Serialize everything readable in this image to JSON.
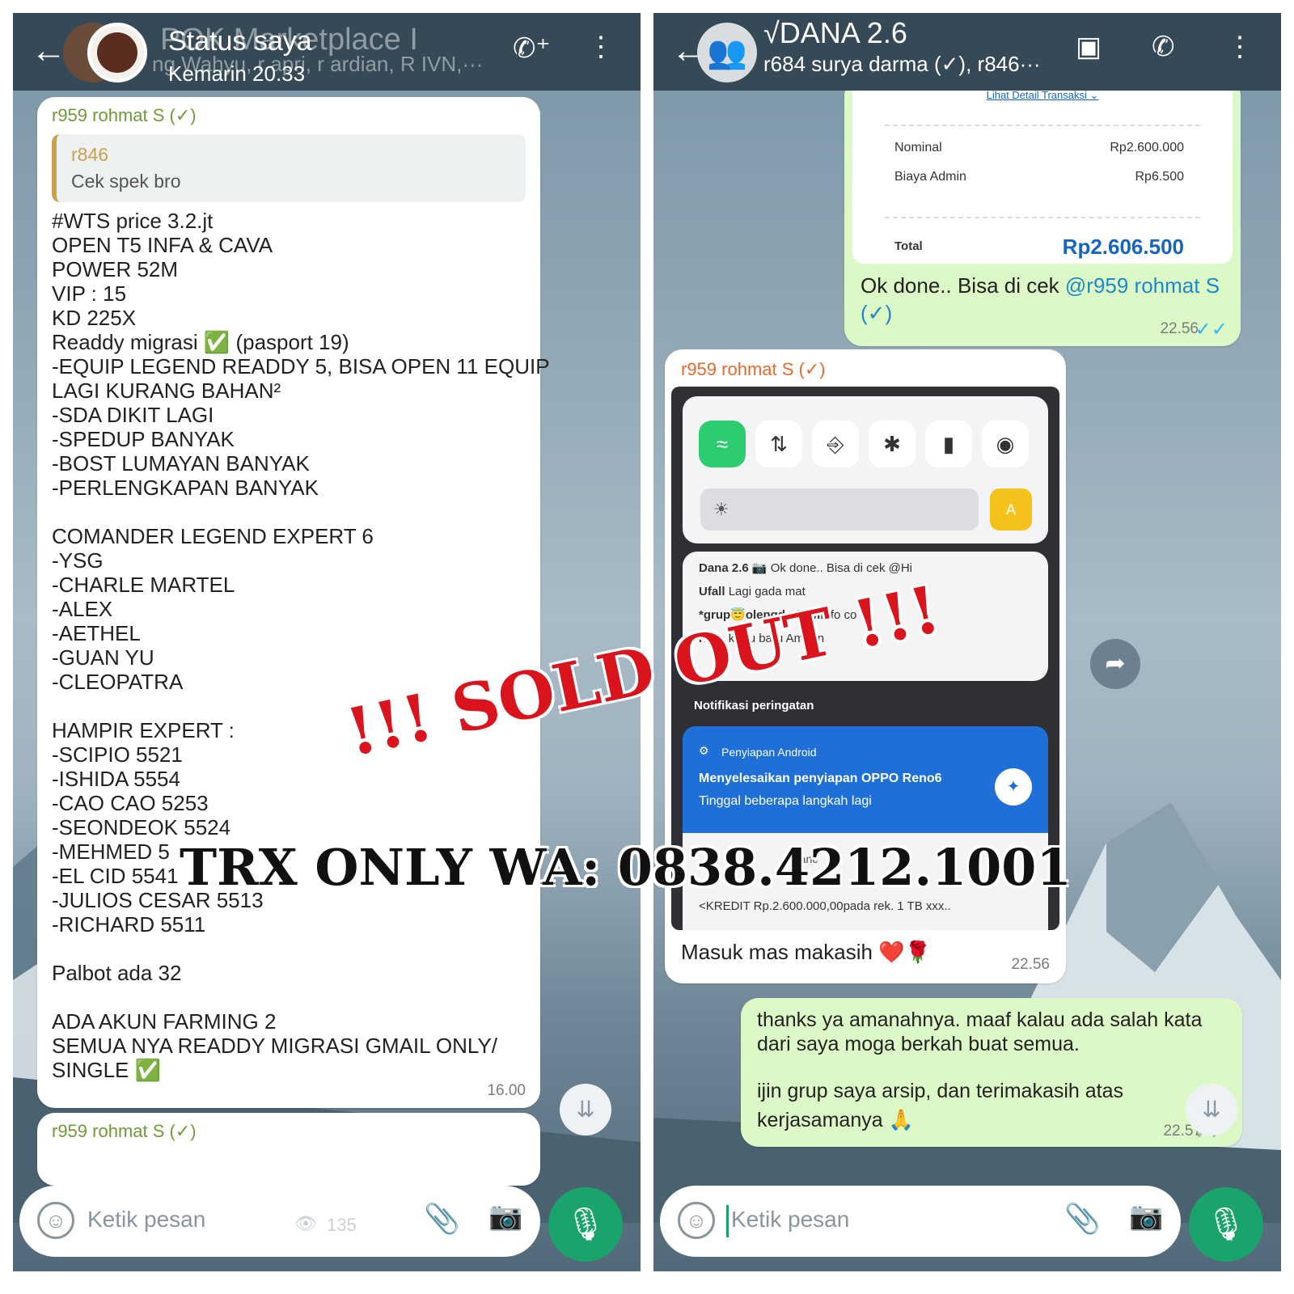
{
  "left": {
    "header": {
      "bg_title": "POK Marketplace I",
      "title": "Status saya",
      "subtitle": "Kemarin 20.33",
      "members": "ng Wahyu, r apri, r ardian, R IVN,···"
    },
    "message": {
      "sender": "r959 rohmat S (✓)",
      "quote_name": "r846",
      "quote_text": "Cek spek bro",
      "lines": [
        "#WTS price 3.2.jt",
        "OPEN T5 INFA & CAVA",
        "POWER 52M",
        "VIP : 15",
        "KD 225X",
        "Readdy migrasi ✅ (pasport 19)",
        "-EQUIP LEGEND READDY 5, BISA OPEN 11 EQUIP",
        "LAGI KURANG BAHAN²",
        "-SDA DIKIT LAGI",
        "-SPEDUP BANYAK",
        "-BOST LUMAYAN BANYAK",
        "-PERLENGKAPAN BANYAK",
        "",
        "COMANDER LEGEND EXPERT 6",
        "-YSG",
        "-CHARLE MARTEL",
        "-ALEX",
        "-AETHEL",
        "-GUAN YU",
        "-CLEOPATRA",
        "",
        "HAMPIR EXPERT :",
        "-SCIPIO 5521",
        "-ISHIDA 5554",
        "-CAO CAO 5253",
        "-SEONDEOK 5524",
        "-MEHMED 5",
        "-EL CID 5541",
        "-JULIOS CESAR 5513",
        "-RICHARD 5511",
        "",
        "Palbot ada 32",
        "",
        "ADA AKUN FARMING 2",
        "SEMUA NYA READDY MIGRASI GMAIL ONLY/",
        "SINGLE ✅"
      ],
      "time": "16.00"
    },
    "next_sender": "r959 rohmat S (✓)",
    "input": {
      "placeholder": "Ketik pesan",
      "views": "135"
    }
  },
  "right": {
    "header": {
      "title": "√DANA 2.6",
      "subtitle": "r684 surya darma (✓), r846···"
    },
    "receipt": {
      "detail_link": "Lihat Detail Transaksi ⌄",
      "rows": [
        {
          "label": "Nominal",
          "value": "Rp2.600.000"
        },
        {
          "label": "Biaya Admin",
          "value": "Rp6.500"
        }
      ],
      "total_label": "Total",
      "total_value": "Rp2.606.500"
    },
    "msg_out1": {
      "text": "Ok done.. Bisa di cek ",
      "mention": "@r959 rohmat S",
      "mention2": "(✓)",
      "time": "22.56"
    },
    "msg_in": {
      "sender": "r959 rohmat S (✓)",
      "notifications": [
        {
          "name": "Dana 2.6",
          "text": "📷 Ok done.. Bisa di cek @Hi"
        },
        {
          "name": "Ufall",
          "text": "Lagi gada mat"
        },
        {
          "name": "*grup😇olengdodowik",
          "text": "fo co"
        },
        {
          "name": "Niko",
          "text": "kartu baru Amann"
        }
      ],
      "warning_title": "Notifikasi peringatan",
      "android_label": "Penyiapan Android",
      "android_title": "Menyelesaikan penyiapan OPPO Reno6",
      "android_sub": "Tinggal beberapa langkah lagi",
      "bank_line": "<KREDIT Rp.2.600.000,00pada rek. 1 TB xxx..",
      "bank_head": "ranc",
      "brightness_auto": "A",
      "text": "Masuk mas makasih ❤️🌹",
      "time": "22.56"
    },
    "msg_out2": {
      "line1": "thanks ya amanahnya. maaf kalau ada salah kata",
      "line2": "dari saya moga berkah buat semua.",
      "line3": "ijin grup saya arsip, dan terimakasih atas",
      "line4": "kerjasamanya 🙏",
      "time": "22.57"
    },
    "input": {
      "placeholder": "Ketik pesan"
    }
  },
  "overlay": {
    "sold_out": "!!! SOLD OUT !!!",
    "trx": "TRX ONLY WA: 0838.4212.1001"
  },
  "colors": {
    "header": "#354a56",
    "out_bubble": "#dcf8c6",
    "mic": "#1aa36a",
    "sold_red": "#d9141c",
    "total_blue": "#1565c0"
  }
}
